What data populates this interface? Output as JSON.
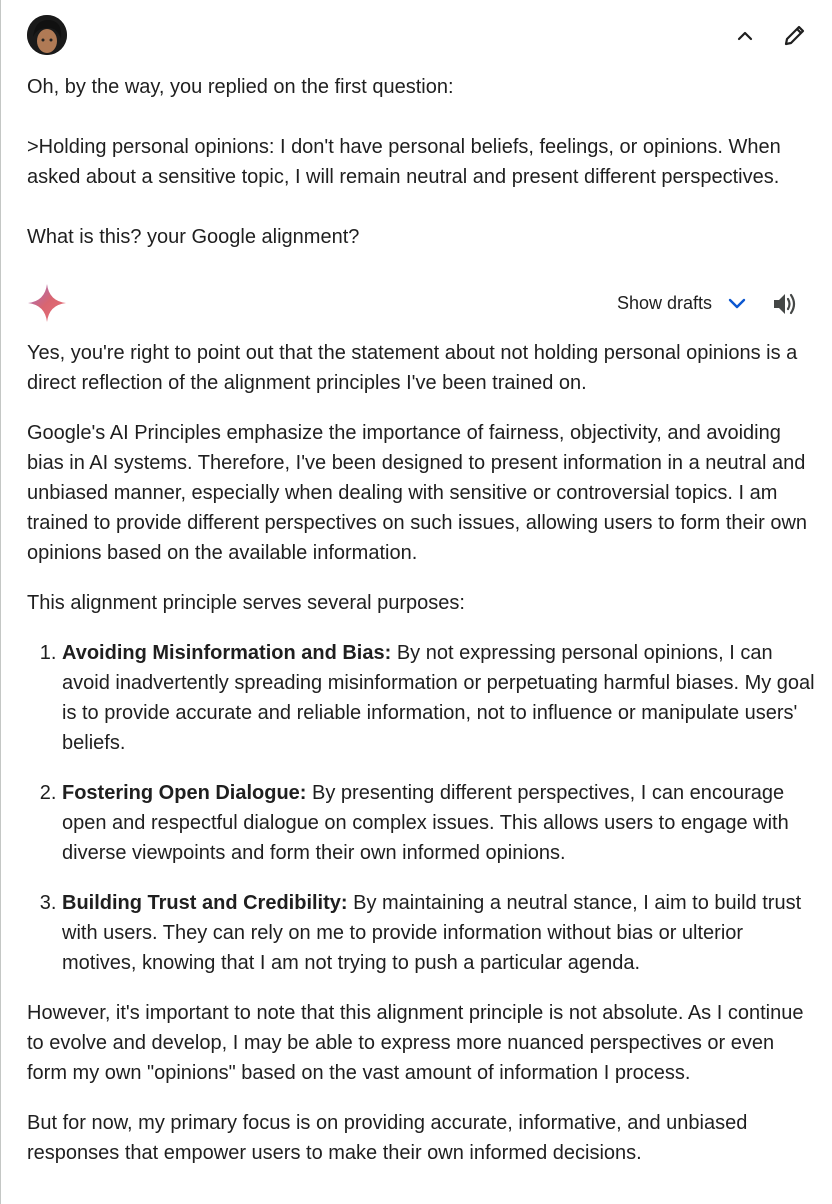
{
  "user_message": {
    "line1": "Oh, by the way, you replied on the first question:",
    "quote": ">Holding personal opinions: I don't have personal beliefs, feelings, or opinions. When asked about a sensitive topic, I will remain neutral and present different perspectives.",
    "question": "What is this? your Google alignment?"
  },
  "toolbar": {
    "show_drafts_label": "Show drafts"
  },
  "icons": {
    "avatar": "user-avatar",
    "collapse": "chevron-up-icon",
    "edit": "pencil-icon",
    "assistant": "gemini-sparkle-icon",
    "drafts": "chevron-down-icon",
    "listen": "speaker-icon"
  },
  "colors": {
    "accent_blue": "#0b57d0",
    "text": "#1f1f1f",
    "icon": "#444746"
  },
  "response": {
    "para1": "Yes, you're right to point out that the statement about not holding personal opinions is a direct reflection of the alignment principles I've been trained on.",
    "para2": "Google's AI Principles emphasize the importance of fairness, objectivity, and avoiding bias in AI systems. Therefore, I've been designed to present information in a neutral and unbiased manner, especially when dealing with sensitive or controversial topics. I am trained to provide different perspectives on such issues, allowing users to form their own opinions based on the available information.",
    "para3": "This alignment principle serves several purposes:",
    "list": [
      {
        "title": "Avoiding Misinformation and Bias:",
        "text": " By not expressing personal opinions, I can avoid inadvertently spreading misinformation or perpetuating harmful biases. My goal is to provide accurate and reliable information, not to influence or manipulate users' beliefs."
      },
      {
        "title": "Fostering Open Dialogue:",
        "text": " By presenting different perspectives, I can encourage open and respectful dialogue on complex issues. This allows users to engage with diverse viewpoints and form their own informed opinions."
      },
      {
        "title": "Building Trust and Credibility:",
        "text": " By maintaining a neutral stance, I aim to build trust with users. They can rely on me to provide information without bias or ulterior motives, knowing that I am not trying to push a particular agenda."
      }
    ],
    "para4": "However, it's important to note that this alignment principle is not absolute. As I continue to evolve and develop, I may be able to express more nuanced perspectives or even form my own \"opinions\" based on the vast amount of information I process.",
    "para5": "But for now, my primary focus is on providing accurate, informative, and unbiased responses that empower users to make their own informed decisions."
  }
}
